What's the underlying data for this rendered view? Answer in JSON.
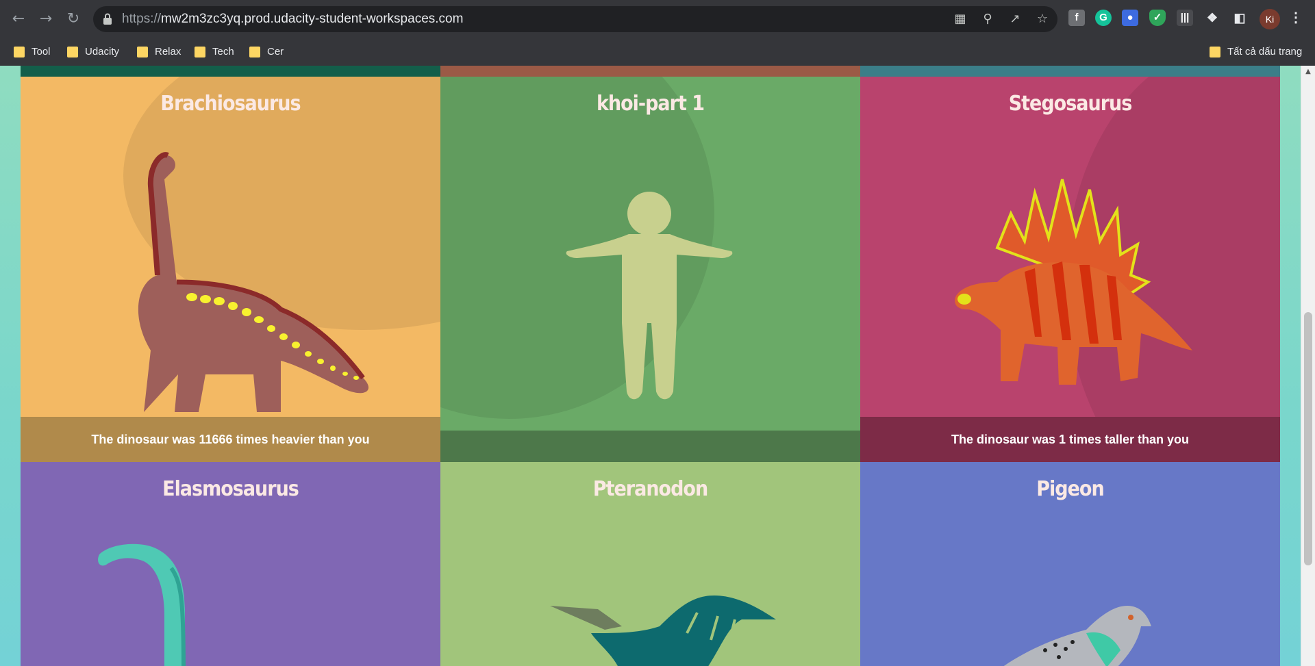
{
  "browser": {
    "url_scheme": "https://",
    "url_host": "mw2m3zc3yq.prod.udacity-student-workspaces.com",
    "avatar_initials": "Ki",
    "bookmarks": [
      "Tool",
      "Udacity",
      "Relax",
      "Tech",
      "Cer"
    ],
    "all_bookmarks_label": "Tất cả dấu trang"
  },
  "tiles": [
    {
      "title": "Brachiosaurus",
      "fact": "The dinosaur was 11666 times heavier than you",
      "color": "#f3b964"
    },
    {
      "title": "khoi-part 1",
      "fact": "",
      "color": "#6aaa67"
    },
    {
      "title": "Stegosaurus",
      "fact": "The dinosaur was 1 times taller than you",
      "color": "#b9436d"
    },
    {
      "title": "Elasmosaurus",
      "fact": "",
      "color": "#8067b4"
    },
    {
      "title": "Pteranodon",
      "fact": "",
      "color": "#a1c57b"
    },
    {
      "title": "Pigeon",
      "fact": "",
      "color": "#6778c7"
    }
  ],
  "icons": [
    "back-icon",
    "forward-icon",
    "reload-icon",
    "lock-icon",
    "translate-icon",
    "zoom-icon",
    "share-icon",
    "star-icon",
    "extensions-icon",
    "side-panel-icon",
    "menu-icon",
    "folder-icon"
  ]
}
